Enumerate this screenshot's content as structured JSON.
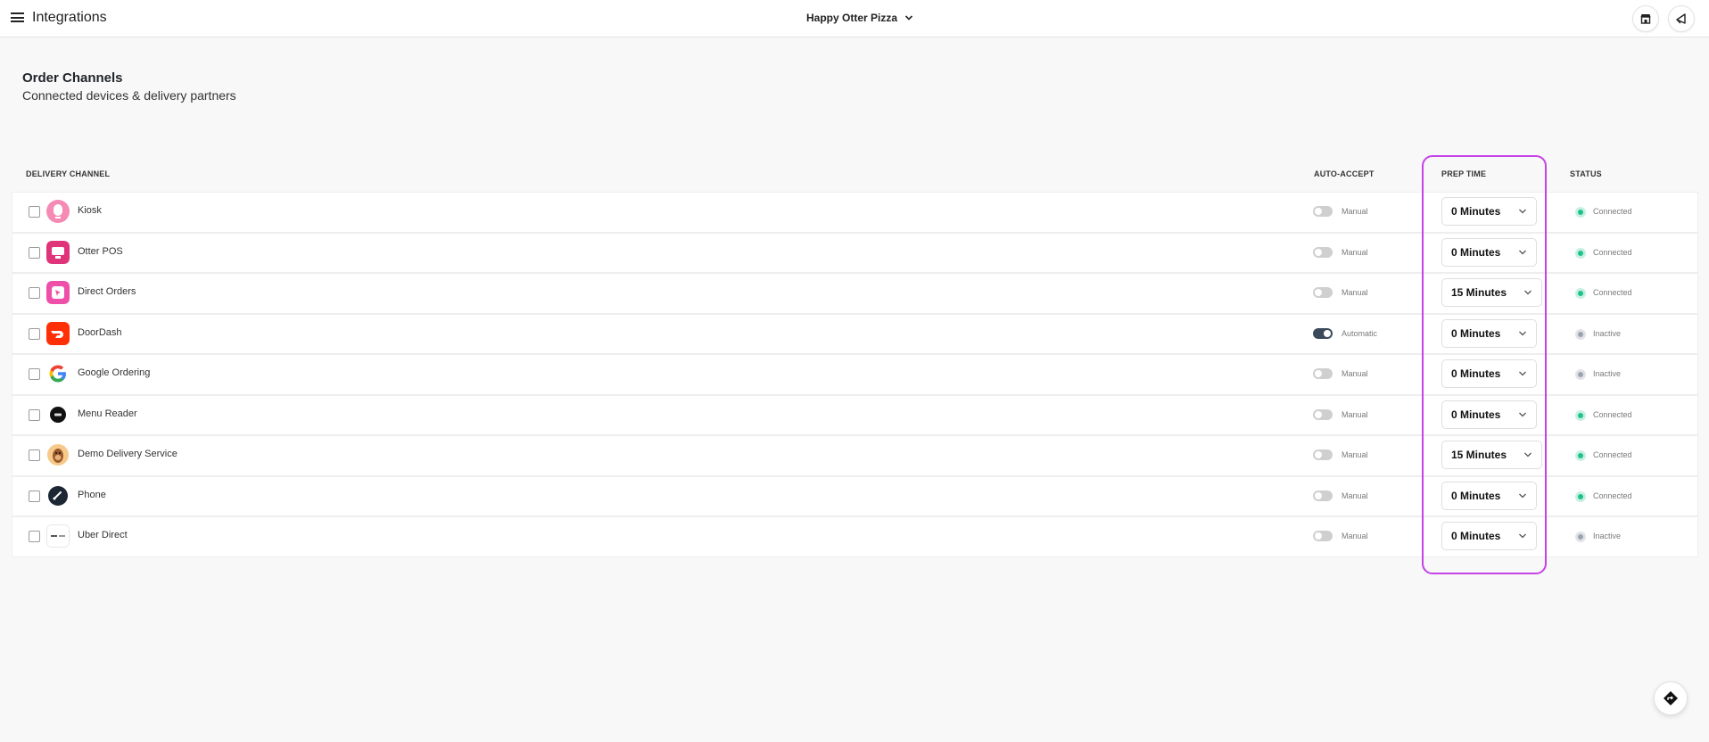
{
  "header": {
    "title": "Integrations",
    "store_name": "Happy Otter Pizza"
  },
  "section": {
    "title": "Order Channels",
    "subtitle": "Connected devices & delivery partners"
  },
  "columns": {
    "channel": "DELIVERY CHANNEL",
    "auto_accept": "AUTO-ACCEPT",
    "prep_time": "PREP TIME",
    "status": "STATUS"
  },
  "colors": {
    "connected": "#1fc28a",
    "inactive": "#9ca3af",
    "highlight": "#c542e6"
  },
  "channels": [
    {
      "name": "Kiosk",
      "icon": "kiosk-icon",
      "auto_accept": "Manual",
      "auto_on": false,
      "prep": "0 Minutes",
      "status": "Connected"
    },
    {
      "name": "Otter POS",
      "icon": "otter-pos-icon",
      "auto_accept": "Manual",
      "auto_on": false,
      "prep": "0 Minutes",
      "status": "Connected"
    },
    {
      "name": "Direct Orders",
      "icon": "direct-orders-icon",
      "auto_accept": "Manual",
      "auto_on": false,
      "prep": "15 Minutes",
      "status": "Connected"
    },
    {
      "name": "DoorDash",
      "icon": "doordash-icon",
      "auto_accept": "Automatic",
      "auto_on": true,
      "prep": "0 Minutes",
      "status": "Inactive"
    },
    {
      "name": "Google Ordering",
      "icon": "google-icon",
      "auto_accept": "Manual",
      "auto_on": false,
      "prep": "0 Minutes",
      "status": "Inactive"
    },
    {
      "name": "Menu Reader",
      "icon": "menu-reader-icon",
      "auto_accept": "Manual",
      "auto_on": false,
      "prep": "0 Minutes",
      "status": "Connected"
    },
    {
      "name": "Demo Delivery Service",
      "icon": "demo-delivery-icon",
      "auto_accept": "Manual",
      "auto_on": false,
      "prep": "15 Minutes",
      "status": "Connected"
    },
    {
      "name": "Phone",
      "icon": "phone-icon",
      "auto_accept": "Manual",
      "auto_on": false,
      "prep": "0 Minutes",
      "status": "Connected"
    },
    {
      "name": "Uber Direct",
      "icon": "uber-direct-icon",
      "auto_accept": "Manual",
      "auto_on": false,
      "prep": "0 Minutes",
      "status": "Inactive"
    }
  ]
}
